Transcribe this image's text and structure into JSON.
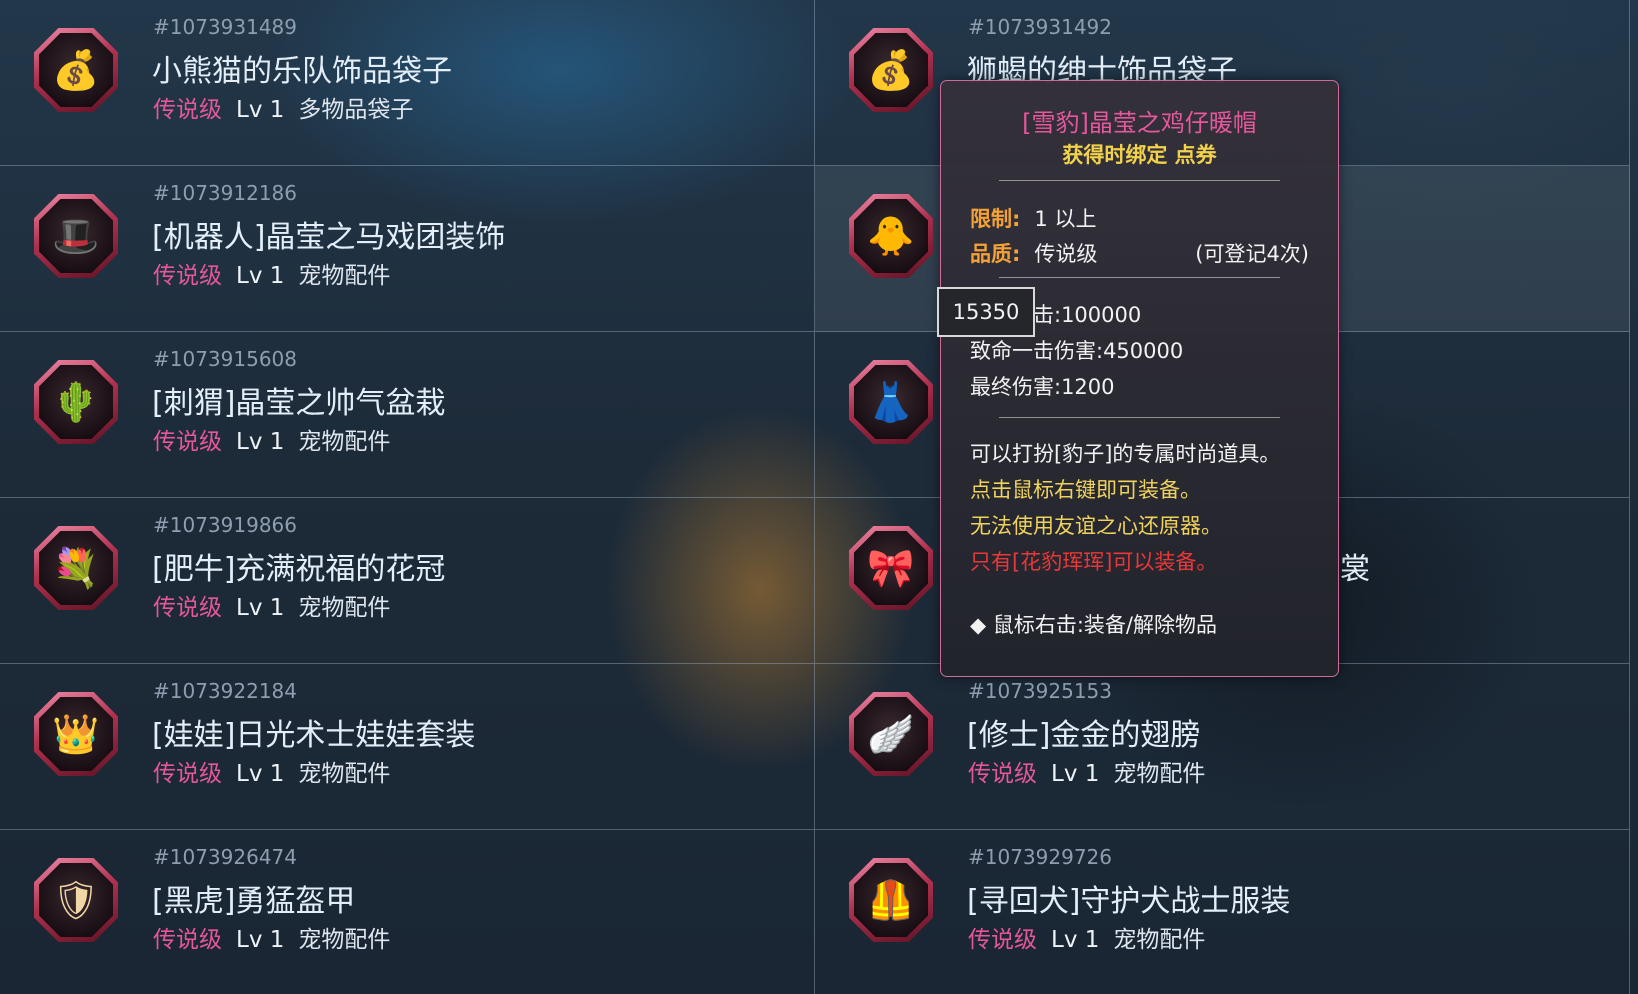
{
  "items": [
    {
      "id": "#1073931489",
      "name": "小熊猫的乐队饰品袋子",
      "rarity": "传说级",
      "level": "Lv 1",
      "type": "多物品袋子",
      "icon": "bag-icon",
      "glyph": "💰",
      "highlight": false
    },
    {
      "id": "#1073931492",
      "name": "狮蝎的绅士饰品袋子",
      "rarity": "",
      "level": "",
      "type": "",
      "icon": "bag-icon",
      "glyph": "💰",
      "highlight": false
    },
    {
      "id": "#1073912186",
      "name": "[机器人]晶莹之马戏团装饰",
      "rarity": "传说级",
      "level": "Lv 1",
      "type": "宠物配件",
      "icon": "circus-hat-icon",
      "glyph": "🎩",
      "highlight": false
    },
    {
      "id": "",
      "name": "",
      "rarity": "",
      "level": "",
      "type": "",
      "icon": "chick-hat-icon",
      "glyph": "🐥",
      "highlight": true
    },
    {
      "id": "#1073915608",
      "name": "[刺猬]晶莹之帅气盆栽",
      "rarity": "传说级",
      "level": "Lv 1",
      "type": "宠物配件",
      "icon": "potted-plant-icon",
      "glyph": "🌵",
      "highlight": false
    },
    {
      "id": "",
      "name": "",
      "rarity": "",
      "level": "",
      "type": "",
      "icon": "skirt-icon",
      "glyph": "👗",
      "highlight": false
    },
    {
      "id": "#1073919866",
      "name": "[肥牛]充满祝福的花冠",
      "rarity": "传说级",
      "level": "Lv 1",
      "type": "宠物配件",
      "icon": "flower-crown-icon",
      "glyph": "💐",
      "highlight": false
    },
    {
      "id": "",
      "name": "裳",
      "rarity": "",
      "level": "",
      "type": "",
      "icon": "red-scarf-icon",
      "glyph": "🎀",
      "highlight": false
    },
    {
      "id": "#1073922184",
      "name": "[娃娃]日光术士娃娃套装",
      "rarity": "传说级",
      "level": "Lv 1",
      "type": "宠物配件",
      "icon": "doll-set-icon",
      "glyph": "👑",
      "highlight": false
    },
    {
      "id": "#1073925153",
      "name": "[修士]金金的翅膀",
      "rarity": "传说级",
      "level": "Lv 1",
      "type": "宠物配件",
      "icon": "wing-icon",
      "glyph": "🪽",
      "highlight": false
    },
    {
      "id": "#1073926474",
      "name": "[黑虎]勇猛盔甲",
      "rarity": "传说级",
      "level": "Lv 1",
      "type": "宠物配件",
      "icon": "armor-icon",
      "glyph": "🛡",
      "highlight": false
    },
    {
      "id": "#1073929726",
      "name": "[寻回犬]守护犬战士服装",
      "rarity": "传说级",
      "level": "Lv 1",
      "type": "宠物配件",
      "icon": "warrior-outfit-icon",
      "glyph": "🦺",
      "highlight": false
    }
  ],
  "tooltip": {
    "title": "[雪豹]晶莹之鸡仔暖帽",
    "bind": "获得时绑定 点券",
    "limit_label": "限制:",
    "limit_value": "1 以上",
    "quality_label": "品质:",
    "quality_value": "传说级",
    "register": "(可登记4次)",
    "stat1": "击:100000",
    "stat2": "致命一击伤害:450000",
    "stat3": "最终伤害:1200",
    "desc1": "可以打扮[豹子]的专属时尚道具。",
    "desc2": "点击鼠标右键即可装备。",
    "desc3": "无法使用友谊之心还原器。",
    "desc4": "只有[花豹珲珲]可以装备。",
    "hint": "◆ 鼠标右击:装备/解除物品"
  },
  "count_popup": "15350"
}
